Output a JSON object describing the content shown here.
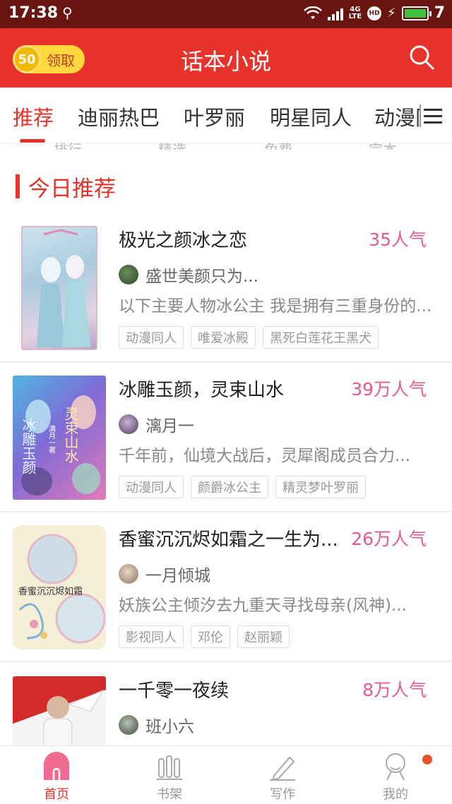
{
  "status_bar": {
    "time": "17:38",
    "network": "4G",
    "network_sub": "LTE",
    "hd": "HD",
    "battery": "7"
  },
  "header": {
    "coin_count": "50",
    "coin_label": "领取",
    "title": "话本小说"
  },
  "tabs": [
    {
      "label": "推荐",
      "active": true
    },
    {
      "label": "迪丽热巴"
    },
    {
      "label": "叶罗丽"
    },
    {
      "label": "明星同人"
    },
    {
      "label": "动漫同"
    }
  ],
  "peek_labels": [
    "排行",
    "精选",
    "免费",
    "完本"
  ],
  "section": {
    "title": "今日推荐"
  },
  "books": [
    {
      "title": "极光之颜冰之恋",
      "popularity": "35人气",
      "author": "盛世美颜只为...",
      "desc": "以下主要人物冰公主 我是拥有三重身份的...",
      "tags": [
        "动漫同人",
        "唯爱冰殿",
        "黑死白莲花王黑犬"
      ]
    },
    {
      "title": "冰雕玉颜，灵束山水",
      "popularity": "39万人气",
      "author": "漓月一",
      "desc": "千年前，仙境大战后，灵犀阁成员合力...",
      "tags": [
        "动漫同人",
        "颜爵冰公主",
        "精灵梦叶罗丽"
      ],
      "cover_text_left": "冰雕玉颜",
      "cover_text_right": "灵束山水",
      "cover_author": "漓月一著"
    },
    {
      "title": "香蜜沉沉烬如霜之一生为...",
      "popularity": "26万人气",
      "author": "一月倾城",
      "desc": "妖族公主倾汐去九重天寻找母亲(风神)...",
      "tags": [
        "影视同人",
        "邓伦",
        "赵丽颖"
      ],
      "cover_text": "香蜜沉沉烬如霜"
    },
    {
      "title": "一千零一夜续",
      "popularity": "8万人气",
      "author": "班小六",
      "desc": "",
      "tags": []
    }
  ],
  "bottom_nav": [
    {
      "label": "首页",
      "icon": "home-icon",
      "active": true
    },
    {
      "label": "书架",
      "icon": "bookshelf-icon"
    },
    {
      "label": "写作",
      "icon": "pen-icon"
    },
    {
      "label": "我的",
      "icon": "profile-icon"
    }
  ],
  "colors": {
    "brand_red": "#e8332c",
    "popularity_pink": "#e65a8c",
    "coin_yellow": "#ffd93b"
  }
}
